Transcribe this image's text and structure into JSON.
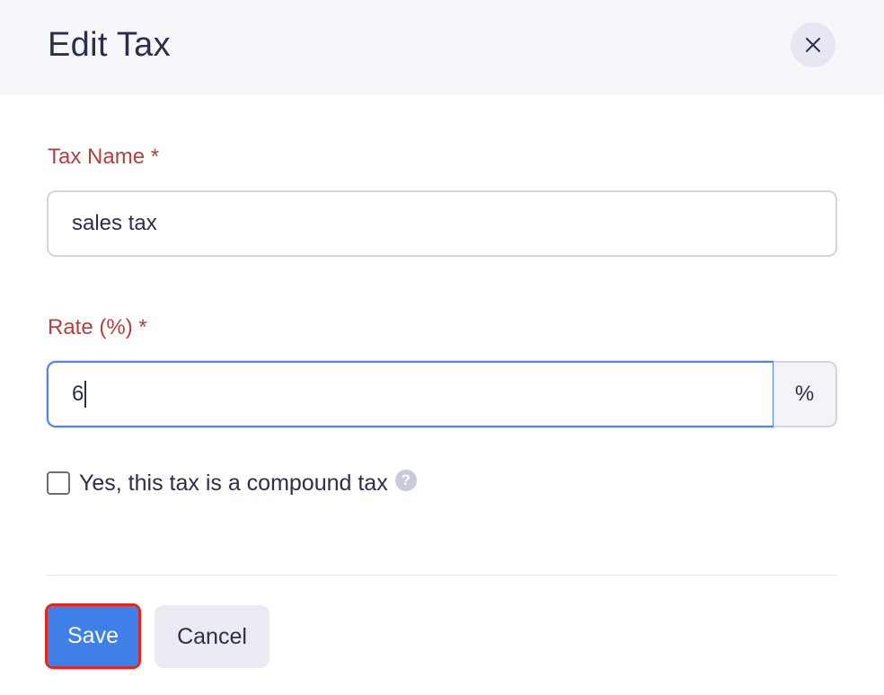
{
  "dialog": {
    "title": "Edit Tax",
    "close_icon": "close-icon"
  },
  "form": {
    "tax_name": {
      "label": "Tax Name *",
      "value": "sales tax"
    },
    "rate": {
      "label": "Rate (%) *",
      "value": "6",
      "suffix": "%"
    },
    "compound": {
      "label": "Yes, this tax is a compound tax",
      "checked": false,
      "help_icon": "question-circle-icon",
      "help_glyph": "?"
    }
  },
  "footer": {
    "save_label": "Save",
    "cancel_label": "Cancel"
  },
  "colors": {
    "header_bg": "#f6f6fb",
    "label": "#b3403f",
    "primary": "#3f7fe8",
    "focus_border": "#4f83e6",
    "highlight": "#e8231a"
  }
}
